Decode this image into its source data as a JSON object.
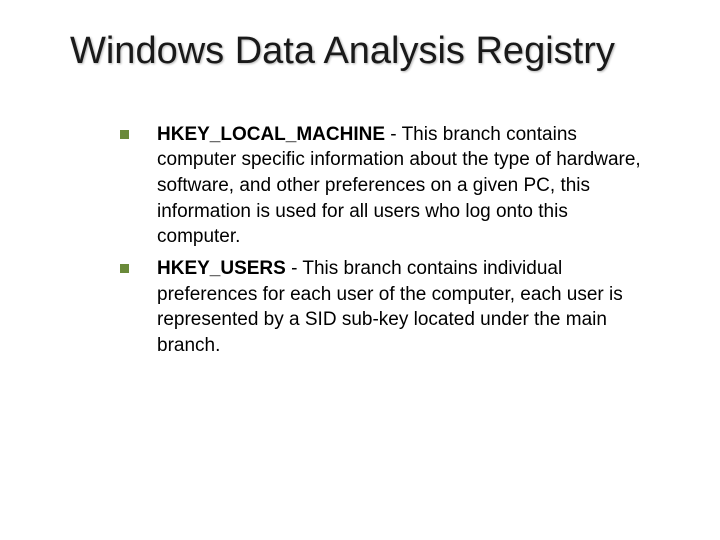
{
  "slide": {
    "title": "Windows Data Analysis Registry",
    "items": [
      {
        "key": "HKEY_LOCAL_MACHINE",
        "description": " - This branch contains computer specific information about the type of hardware, software, and other preferences on a given PC, this information is used for all users who log onto this computer."
      },
      {
        "key": "HKEY_USERS",
        "description": " - This branch contains individual preferences for each user of the computer, each user is represented by a SID sub-key located under the main branch."
      }
    ]
  }
}
